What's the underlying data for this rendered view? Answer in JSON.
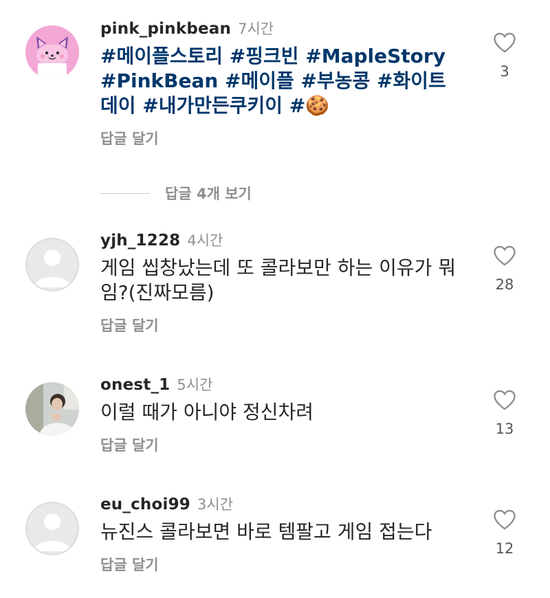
{
  "comments": [
    {
      "username": "pink_pinkbean",
      "time": "7시간",
      "text": "#메이플스토리 #핑크빈 #MapleStory #PinkBean #메이플 #부농콩 #화이트데이 #내가만든쿠키이 #🍪",
      "reply": "답글 달기",
      "likes": "3",
      "avatar": "pink-bean-avatar",
      "heart_icon": "heart-outline-icon"
    },
    {
      "username": "yjh_1228",
      "time": "4시간",
      "text": "게임 씹창났는데 또 콜라보만 하는 이유가 뭐임?(진짜모름)",
      "reply": "답글 달기",
      "likes": "28",
      "avatar": "default-avatar",
      "heart_icon": "heart-outline-icon"
    },
    {
      "username": "onest_1",
      "time": "5시간",
      "text": "이럴 때가 아니야 정신차려",
      "reply": "답글 달기",
      "likes": "13",
      "avatar": "photo-avatar",
      "heart_icon": "heart-outline-icon"
    },
    {
      "username": "eu_choi99",
      "time": "3시간",
      "text": "뉴진스 콜라보면 바로 템팔고 게임 접는다",
      "reply": "답글 달기",
      "likes": "12",
      "avatar": "default-avatar",
      "heart_icon": "heart-outline-icon"
    }
  ],
  "view_replies_label": "답글 4개 보기",
  "colors": {
    "hashtag": "#00376b",
    "muted": "#8e8e8e",
    "text": "#262626",
    "pink_avatar": "#f3a7d4"
  }
}
